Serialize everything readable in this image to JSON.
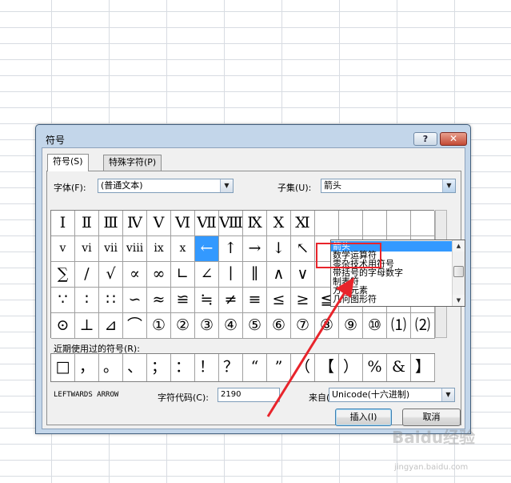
{
  "dialog": {
    "title": "符号",
    "help_label": "?",
    "close_label": "✕"
  },
  "tabs": [
    {
      "label": "符号(S)",
      "active": true
    },
    {
      "label": "特殊字符(P)",
      "active": false
    }
  ],
  "font": {
    "label": "字体(F):",
    "value": "(普通文本)"
  },
  "subset": {
    "label": "子集(U):",
    "value": "箭头",
    "options": [
      "箭头",
      "数学运算符",
      "零杂技术用符号",
      "带括号的字母数字",
      "制表符",
      "方块元素",
      "几何图形符"
    ],
    "highlighted_index": 0
  },
  "symbol_grid": {
    "rows": [
      [
        "Ⅰ",
        "Ⅱ",
        "Ⅲ",
        "Ⅳ",
        "Ⅴ",
        "Ⅵ",
        "Ⅶ",
        "Ⅷ",
        "Ⅸ",
        "Ⅹ",
        "Ⅺ",
        "",
        "",
        "",
        "",
        ""
      ],
      [
        "ⅴ",
        "ⅵ",
        "ⅶ",
        "ⅷ",
        "ⅸ",
        "ⅹ",
        "←",
        "↑",
        "→",
        "↓",
        "↖",
        "",
        "",
        "",
        "",
        ""
      ],
      [
        "∑",
        "∕",
        "√",
        "∝",
        "∞",
        "∟",
        "∠",
        "∣",
        "∥",
        "∧",
        "∨",
        "",
        "",
        "",
        "∮",
        "∴"
      ],
      [
        "∵",
        "∶",
        "∷",
        "∽",
        "≈",
        "≌",
        "≒",
        "≠",
        "≡",
        "≤",
        "≥",
        "≦",
        "≧",
        "≮",
        "≯",
        "⊕"
      ],
      [
        "⊙",
        "⊥",
        "⊿",
        "⌒",
        "①",
        "②",
        "③",
        "④",
        "⑤",
        "⑥",
        "⑦",
        "⑧",
        "⑨",
        "⑩",
        "⑴",
        "⑵"
      ]
    ],
    "selected": {
      "row": 1,
      "col": 6
    }
  },
  "recent": {
    "label": "近期使用过的符号(R):",
    "symbols": [
      "□",
      "，",
      "。",
      "、",
      "；",
      "：",
      "！",
      "？",
      "“",
      "”",
      "（",
      "【",
      "）",
      "%",
      "&",
      "】"
    ]
  },
  "char_name": "LEFTWARDS ARROW",
  "char_code": {
    "label": "字符代码(C):",
    "value": "2190"
  },
  "from": {
    "label": "来自(M):",
    "value": "Unicode(十六进制)"
  },
  "buttons": {
    "insert": "插入(I)",
    "cancel": "取消"
  },
  "annotation": {
    "color": "#e8242b"
  },
  "watermark": {
    "text": "Baidu经验",
    "sub": "jingyan.baidu.com"
  }
}
